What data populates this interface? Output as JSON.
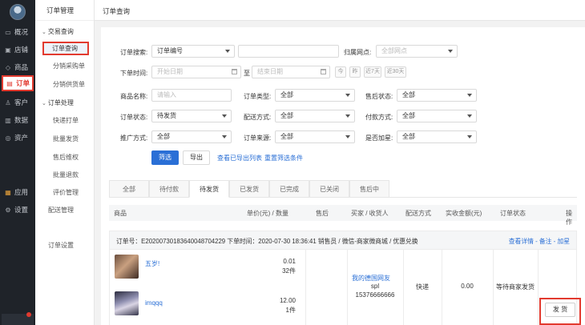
{
  "rail": {
    "items": [
      {
        "icon": "monitor-icon",
        "glyph": "▭",
        "label": "概况"
      },
      {
        "icon": "shop-icon",
        "glyph": "▣",
        "label": "店铺"
      },
      {
        "icon": "tag-icon",
        "glyph": "◇",
        "label": "商品"
      },
      {
        "icon": "order-icon",
        "glyph": "▤",
        "label": "订单"
      },
      {
        "icon": "user-icon",
        "glyph": "♙",
        "label": "客户"
      },
      {
        "icon": "chart-icon",
        "glyph": "▥",
        "label": "数据"
      },
      {
        "icon": "asset-icon",
        "glyph": "◎",
        "label": "资产"
      },
      {
        "icon": "apps-icon",
        "glyph": "▦",
        "label": "应用"
      },
      {
        "icon": "gear-icon",
        "glyph": "⚙",
        "label": "设置"
      }
    ]
  },
  "side": {
    "title": "订单管理",
    "groups": [
      {
        "label": "交易查询"
      },
      {
        "label": "订单处理"
      }
    ],
    "items": [
      "订单查询",
      "分销采购单",
      "分销供货单",
      "快递打单",
      "批量发货",
      "售后维权",
      "批量退款",
      "评价管理",
      "配送管理",
      "订单设置"
    ]
  },
  "page": {
    "title": "订单查询"
  },
  "filters": {
    "search_label": "订单搜索:",
    "search_type": "订单编号",
    "belong_label": "归属网点:",
    "belong_placeholder": "全部网点",
    "time_label": "下单时间:",
    "start_placeholder": "开始日期",
    "to": "至",
    "end_placeholder": "结束日期",
    "quick": [
      "今",
      "昨",
      "近7天",
      "近30天"
    ],
    "goods_label": "商品名称:",
    "goods_placeholder": "请输入",
    "type_label": "订单类型:",
    "type_value": "全部",
    "after_label": "售后状态:",
    "after_value": "全部",
    "status_label": "订单状态:",
    "status_value": "待发货",
    "delivery_label": "配送方式:",
    "delivery_value": "全部",
    "pay_label": "付款方式:",
    "pay_value": "全部",
    "promo_label": "推广方式:",
    "promo_value": "全部",
    "source_label": "订单来源:",
    "source_value": "全部",
    "star_label": "是否加星:",
    "star_value": "全部",
    "btn_filter": "筛选",
    "btn_export": "导出",
    "link_exported": "查看已导出列表",
    "link_reset": "重置筛选条件"
  },
  "tabs": [
    "全部",
    "待付款",
    "待发货",
    "已发货",
    "已完成",
    "已关闭",
    "售后中"
  ],
  "table_headers": {
    "goods": "商品",
    "price_qty": "单价(元) / 数量",
    "after": "售后",
    "buyer": "买家 / 收货人",
    "delivery": "配送方式",
    "paid": "实收金额(元)",
    "status": "订单状态",
    "ops": "操作"
  },
  "order": {
    "meta": "订单号：E20200730183640048704229   下单时间：2020-07-30 18:36:41   销售员 / 微信-商家微商城 / 优惠兑换",
    "actions": "查看详情 - 备注 - 加星",
    "items": [
      {
        "name": "五岁!",
        "price": "0.01",
        "qty": "32件"
      },
      {
        "name": "imqqq",
        "price": "12.00",
        "qty": "1件"
      }
    ],
    "buyer_name": "我的德国网友",
    "receiver": "spl",
    "phone": "15376666666",
    "delivery": "快递",
    "paid": "0.00",
    "status": "等待商家发货",
    "ship_button": "发 货"
  },
  "colors": {
    "accent": "#2a6fd6",
    "highlight": "#e23a2f",
    "rail": "#1f2329"
  }
}
